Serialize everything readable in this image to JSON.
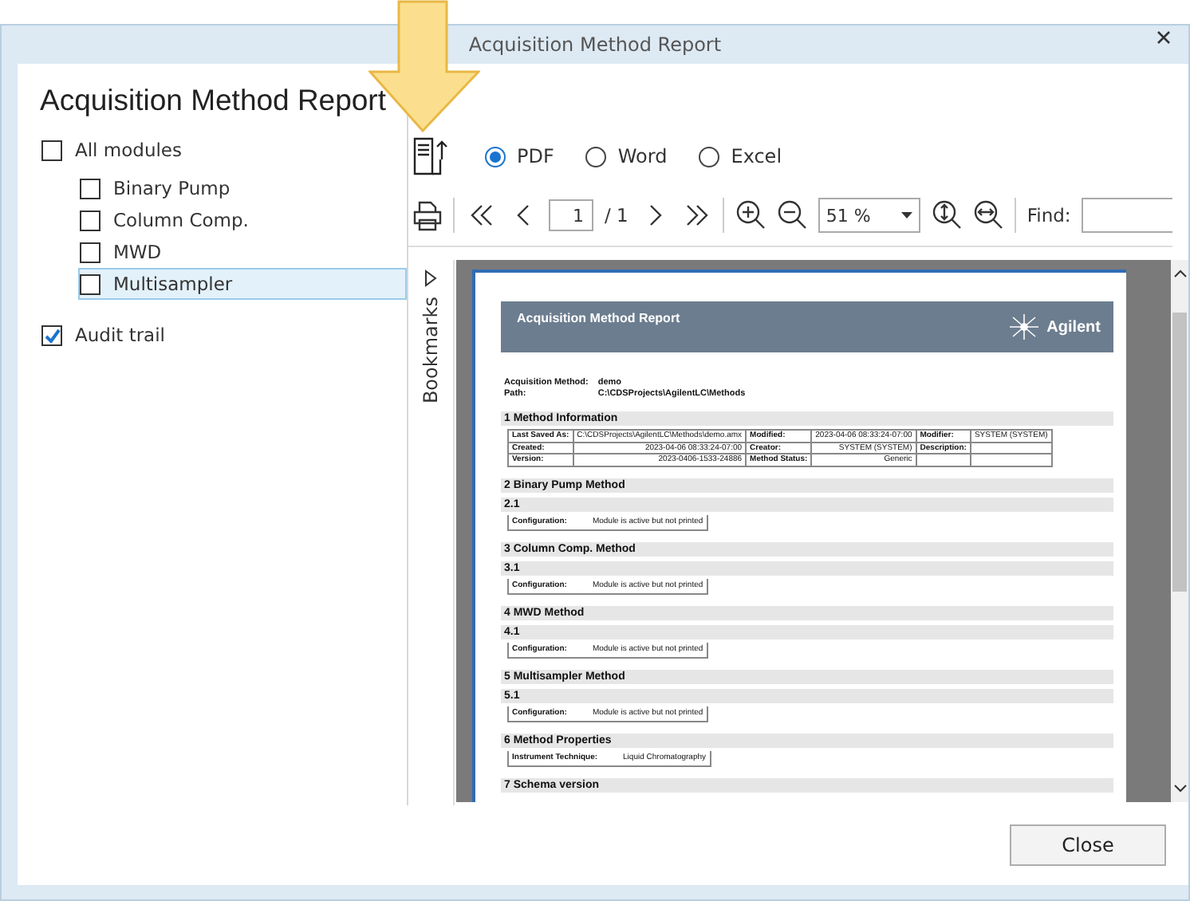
{
  "window": {
    "title": "Acquisition Method Report"
  },
  "heading": "Acquisition Method Report",
  "all_modules": {
    "label": "All modules",
    "checked": false
  },
  "modules": [
    {
      "label": "Binary Pump",
      "checked": false,
      "selected": false
    },
    {
      "label": "Column Comp.",
      "checked": false,
      "selected": false
    },
    {
      "label": "MWD",
      "checked": false,
      "selected": false
    },
    {
      "label": "Multisampler",
      "checked": false,
      "selected": true
    }
  ],
  "audit_trail": {
    "label": "Audit trail",
    "checked": true
  },
  "formats": [
    {
      "label": "PDF",
      "selected": true
    },
    {
      "label": "Word",
      "selected": false
    },
    {
      "label": "Excel",
      "selected": false
    }
  ],
  "toolbar": {
    "page": "1",
    "page_total": "/ 1",
    "zoom": "51 %",
    "find_label": "Find:"
  },
  "bookmarks_label": "Bookmarks",
  "document": {
    "title": "Acquisition Method Report",
    "logo": "Agilent",
    "meta": [
      {
        "label": "Acquisition Method:",
        "value": "demo"
      },
      {
        "label": "Path:",
        "value": "C:\\CDSProjects\\AgilentLC\\Methods"
      }
    ],
    "sections": [
      {
        "number": "1",
        "title": "Method Information",
        "table": [
          [
            "Last Saved As:",
            "C:\\CDSProjects\\AgilentLC\\Methods\\demo.amx",
            "Modified:",
            "2023-04-06 08:33:24-07:00",
            "Modifier:",
            "SYSTEM (SYSTEM)"
          ],
          [
            "Created:",
            "2023-04-06 08:33:24-07:00",
            "Creator:",
            "SYSTEM (SYSTEM)",
            "Description:"
          ],
          [
            "Version:",
            "2023-0406-1533-24886",
            "Method Status:",
            "Generic"
          ]
        ]
      },
      {
        "number": "2",
        "title": "Binary Pump Method",
        "subsections": [
          {
            "number": "2.1",
            "fields": [
              {
                "label": "Configuration:",
                "value": "Module is active but not printed"
              }
            ]
          }
        ]
      },
      {
        "number": "3",
        "title": "Column Comp. Method",
        "subsections": [
          {
            "number": "3.1",
            "fields": [
              {
                "label": "Configuration:",
                "value": "Module is active but not printed"
              }
            ]
          }
        ]
      },
      {
        "number": "4",
        "title": "MWD Method",
        "subsections": [
          {
            "number": "4.1",
            "fields": [
              {
                "label": "Configuration:",
                "value": "Module is active but not printed"
              }
            ]
          }
        ]
      },
      {
        "number": "5",
        "title": "Multisampler Method",
        "subsections": [
          {
            "number": "5.1",
            "fields": [
              {
                "label": "Configuration:",
                "value": "Module is active but not printed"
              }
            ]
          }
        ]
      },
      {
        "number": "6",
        "title": "Method Properties",
        "fields": [
          {
            "label": "Instrument Technique:",
            "value": "Liquid Chromatography"
          }
        ]
      },
      {
        "number": "7",
        "title": "Schema version"
      }
    ]
  },
  "buttons": [
    {
      "label": "Close"
    }
  ]
}
